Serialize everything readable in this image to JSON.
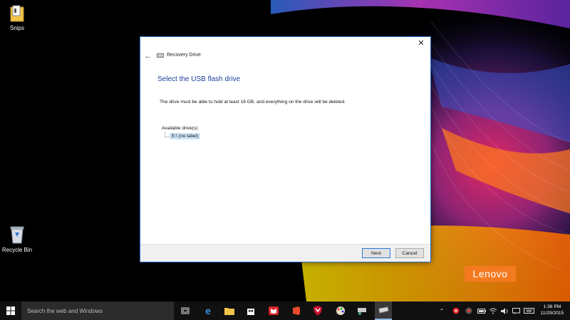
{
  "desktop": {
    "icons": [
      {
        "label": "Snips"
      },
      {
        "label": "Recycle Bin"
      }
    ],
    "brand": "Lenovo"
  },
  "window": {
    "nav_title": "Recovery Drive",
    "heading": "Select the USB flash drive",
    "description": "The drive must be able to hold at least 16 GB, and everything on the drive will be deleted.",
    "drives_label": "Available drive(s)",
    "drives": [
      {
        "label": "E:\\ (no label)",
        "selected": true
      }
    ],
    "buttons": {
      "next": "Next",
      "cancel": "Cancel"
    },
    "close_glyph": "✕",
    "back_glyph": "←"
  },
  "taskbar": {
    "search_placeholder": "Search the web and Windows",
    "apps": [
      "task-view",
      "edge",
      "file-explorer",
      "store",
      "red-app",
      "office-app",
      "mcafee",
      "paint-app",
      "network-app",
      "recovery-drive"
    ],
    "clock": {
      "time": "1:36 PM",
      "date": "11/29/2015"
    }
  },
  "colors": {
    "accent": "#2b6cc4",
    "heading": "#1e3e9c",
    "selection": "#cce4f7",
    "taskbar": "#101010",
    "lenovo": "#f47a20"
  }
}
